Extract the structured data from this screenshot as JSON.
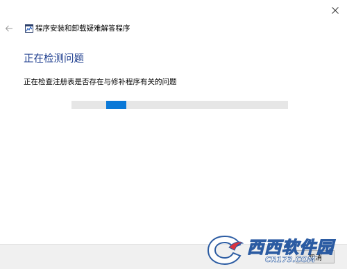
{
  "app": {
    "title": "程序安装和卸载疑难解答程序",
    "icon": "troubleshooter-icon"
  },
  "titlebar": {
    "close_icon": "close-icon",
    "back_icon": "back-arrow-icon"
  },
  "main": {
    "heading": "正在检测问题",
    "status": "正在检查注册表是否存在与修补程序有关的问题",
    "progress_mode": "indeterminate"
  },
  "footer": {
    "button_label": "取消"
  },
  "watermark": {
    "brand": "西西软件园",
    "site": "CR173.COM"
  },
  "colors": {
    "heading": "#1e3e8f",
    "progress_chunk": "#0a78d7",
    "progress_track": "#e6e6e6",
    "footer_bg": "#f0f0f0"
  }
}
